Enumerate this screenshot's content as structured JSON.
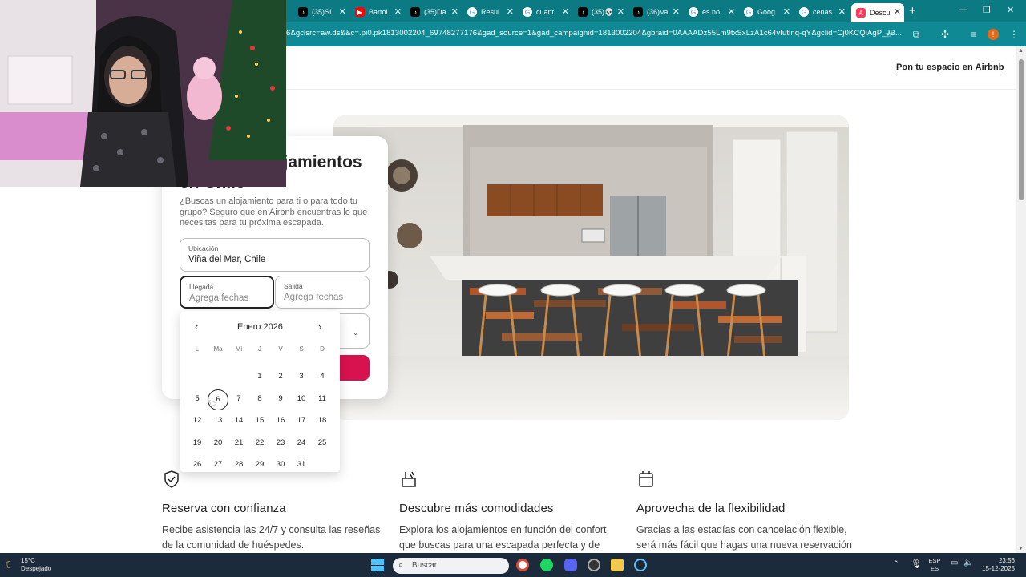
{
  "browser": {
    "tabs": [
      {
        "label": "(35)Sí",
        "icon": "tiktok-icon",
        "color": "#000000"
      },
      {
        "label": "Bartol",
        "icon": "youtube-icon",
        "color": "#ff0000"
      },
      {
        "label": "(35)Da",
        "icon": "tiktok-icon",
        "color": "#000000"
      },
      {
        "label": "Resul",
        "icon": "google-icon",
        "color": "#4285f4"
      },
      {
        "label": "cuant",
        "icon": "google-icon",
        "color": "#4285f4"
      },
      {
        "label": "(35)💀",
        "icon": "tiktok-icon",
        "color": "#000000"
      },
      {
        "label": "(36)Va",
        "icon": "tiktok-icon",
        "color": "#000000"
      },
      {
        "label": "es no",
        "icon": "google-icon",
        "color": "#4285f4"
      },
      {
        "label": "Goog",
        "icon": "google-icon",
        "color": "#4285f4"
      },
      {
        "label": "cenas",
        "icon": "google-icon",
        "color": "#4285f4"
      },
      {
        "label": "Descu",
        "icon": "airbnb-icon",
        "color": "#ff385c"
      }
    ],
    "url": "6&gclsrc=aw.ds&&c=.pi0.pk1813002204_69748277176&gad_source=1&gad_campaignid=1813002204&gbraid=0AAAADz55Lm9txSxLzA1c64vIutlnq-qY&gclid=Cj0KCQiAgP_JB...",
    "accent": "#0b7a83"
  },
  "header": {
    "host_link": "Pon tu espacio en Airbnb"
  },
  "search_card": {
    "title": "Hoteles y alojamientos en Chile",
    "subtitle": "¿Buscas un alojamiento para ti o para todo tu grupo? Seguro que en Airbnb encuentras lo que necesitas para tu próxima escapada.",
    "location": {
      "label": "Ubicación",
      "value": "Viña del Mar, Chile"
    },
    "checkin": {
      "label": "Llegada",
      "placeholder": "Agrega fechas"
    },
    "checkout": {
      "label": "Salida",
      "placeholder": "Agrega fechas"
    },
    "search_color": "#d8124f"
  },
  "calendar": {
    "month": "Enero 2026",
    "weekdays": [
      "L",
      "Ma",
      "Mi",
      "J",
      "V",
      "S",
      "D"
    ],
    "weeks": [
      [
        "",
        "",
        "",
        "1",
        "2",
        "3",
        "4"
      ],
      [
        "5",
        "6",
        "7",
        "8",
        "9",
        "10",
        "11"
      ],
      [
        "12",
        "13",
        "14",
        "15",
        "16",
        "17",
        "18"
      ],
      [
        "19",
        "20",
        "21",
        "22",
        "23",
        "24",
        "25"
      ],
      [
        "26",
        "27",
        "28",
        "29",
        "30",
        "31",
        ""
      ]
    ],
    "highlighted_day": "6"
  },
  "features": [
    {
      "title": "Reserva con confianza",
      "text": "Recibe asistencia las 24/7 y consulta las reseñas de la comunidad de huéspedes.",
      "icon": "shield-check-icon"
    },
    {
      "title": "Descubre más comodidades",
      "text": "Explora los alojamientos en función del confort que buscas para una escapada perfecta y de",
      "icon": "kitchen-tools-icon"
    },
    {
      "title": "Aprovecha de la flexibilidad",
      "text": "Gracias a las estadías con cancelación flexible, será más fácil que hagas una nueva reservación",
      "icon": "calendar-check-icon"
    }
  ],
  "taskbar": {
    "weather_temp": "15°C",
    "weather_desc": "Despejado",
    "search_label": "Buscar",
    "lang_top": "ESP",
    "lang_bottom": "ES",
    "time": "23:56",
    "date": "15-12-2025"
  }
}
